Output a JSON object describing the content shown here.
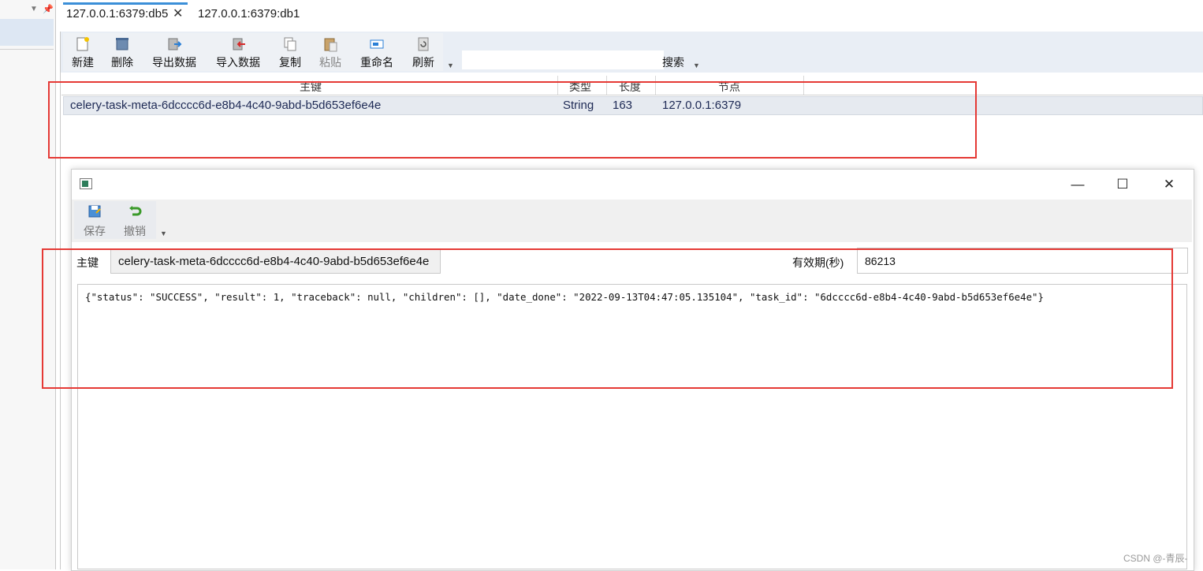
{
  "tabs": [
    {
      "label": "127.0.0.1:6379:db5",
      "active": true
    },
    {
      "label": "127.0.0.1:6379:db1",
      "active": false
    }
  ],
  "toolbar": {
    "new": "新建",
    "delete": "删除",
    "export": "导出数据",
    "import": "导入数据",
    "copy": "复制",
    "paste": "粘贴",
    "rename": "重命名",
    "refresh": "刷新",
    "search_value": "",
    "search_label": "搜索"
  },
  "table": {
    "headers": {
      "key": "主键",
      "type": "类型",
      "length": "长度",
      "node": "节点"
    },
    "rows": [
      {
        "key": "celery-task-meta-6dcccc6d-e8b4-4c40-9abd-b5d653ef6e4e",
        "type": "String",
        "length": "163",
        "node": "127.0.0.1:6379"
      }
    ]
  },
  "dialog": {
    "toolbar": {
      "save": "保存",
      "undo": "撤销"
    },
    "key_label": "主键",
    "key_value": "celery-task-meta-6dcccc6d-e8b4-4c40-9abd-b5d653ef6e4e",
    "ttl_label": "有效期(秒)",
    "ttl_value": "86213",
    "value": "{\"status\": \"SUCCESS\", \"result\": 1, \"traceback\": null, \"children\": [], \"date_done\": \"2022-09-13T04:47:05.135104\", \"task_id\": \"6dcccc6d-e8b4-4c40-9abd-b5d653ef6e4e\"}",
    "controls": {
      "minimize": "—",
      "maximize": "☐",
      "close": "✕"
    }
  },
  "watermark": "CSDN @-青辰-",
  "colors": {
    "annotation_red": "#e53935",
    "tab_accent": "#3b8fd8"
  }
}
